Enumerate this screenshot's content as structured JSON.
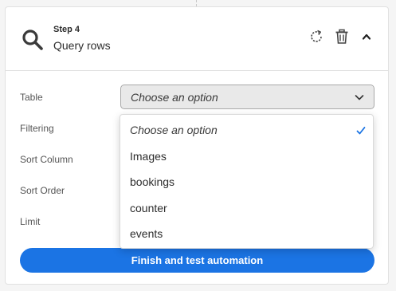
{
  "step": {
    "label": "Step 4",
    "name": "Query rows"
  },
  "icons": {
    "step": "search-icon",
    "refresh": "refresh-icon",
    "delete": "trash-icon",
    "collapse": "chevron-up-icon",
    "select": "chevron-down-icon",
    "selected": "check-icon"
  },
  "fields": {
    "table": "Table",
    "filtering": "Filtering",
    "sort_column": "Sort Column",
    "sort_order": "Sort Order",
    "limit": "Limit"
  },
  "table_select": {
    "value": "Choose an option"
  },
  "dropdown": {
    "options": [
      "Choose an option",
      "Images",
      "bookings",
      "counter",
      "events"
    ],
    "selected": "Choose an option"
  },
  "finish_button": {
    "label": "Finish and test automation"
  },
  "colors": {
    "accent": "#1b74e4",
    "check": "#1b74e4"
  }
}
